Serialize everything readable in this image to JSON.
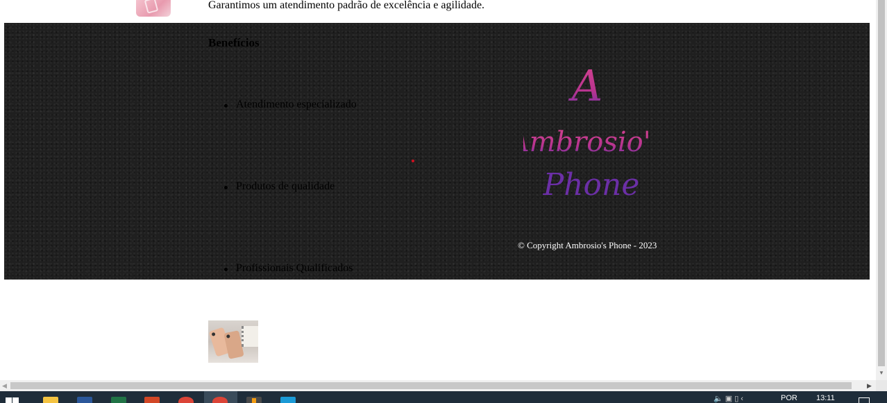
{
  "intro": {
    "text": "Garantimos um atendimento padrão de excelência e agilidade."
  },
  "footer": {
    "benefits_title": "Benefícios",
    "benefits": [
      "Atendimento especializado",
      "Produtos de qualidade",
      "Profissionais Qualificados"
    ],
    "logo": {
      "line1": "A",
      "line2": "Ambrosio's",
      "line3": "Phone"
    },
    "copyright": "© Copyright Ambrosio's Phone - 2023"
  },
  "colors": {
    "footer_bg": "#1f1f1f",
    "logo_pink": "#d5448f",
    "logo_purple": "#6b2fa6",
    "copyright_text": "#ffffff",
    "taskbar": "#1f2d3a"
  },
  "taskbar": {
    "apps": [
      "start-icon",
      "file-explorer-icon",
      "word-icon",
      "excel-icon",
      "powerpoint-icon",
      "chrome-icon",
      "chrome-icon",
      "app-icon",
      "app-icon"
    ],
    "language": "POR",
    "time": "13:11"
  }
}
